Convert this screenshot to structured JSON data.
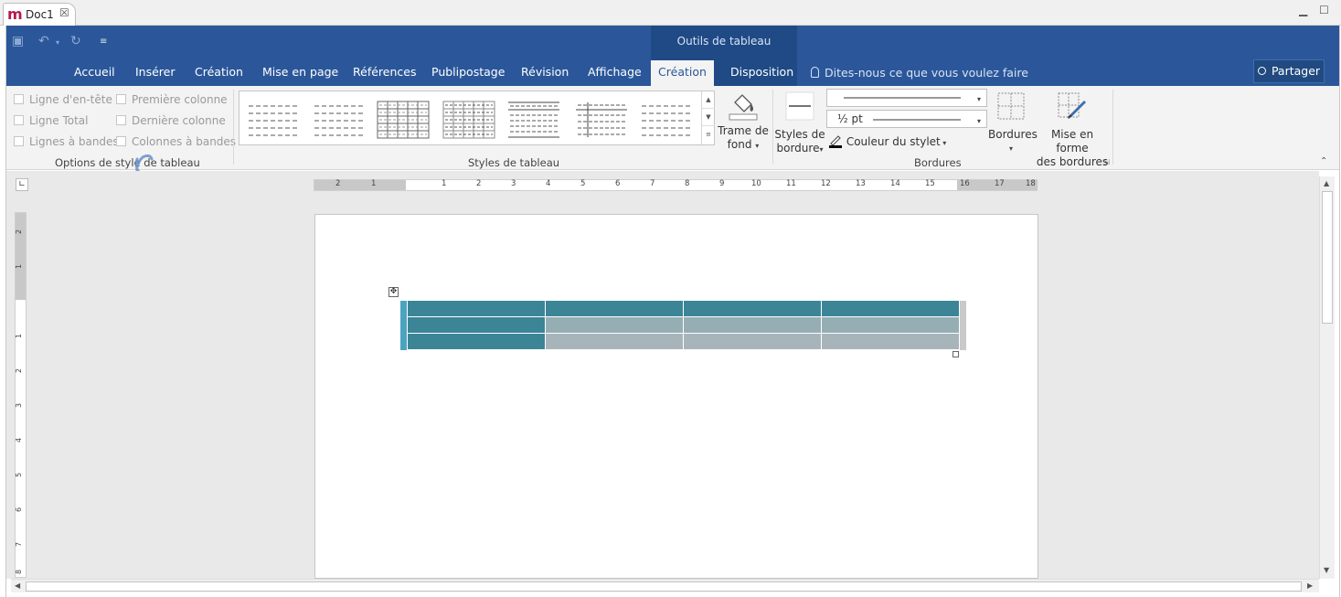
{
  "window": {
    "doc_title": "Doc1",
    "app_logo": "m"
  },
  "context_group_label": "Outils de tableau",
  "tabs": [
    "Accueil",
    "Insérer",
    "Création",
    "Mise en page",
    "Références",
    "Publipostage",
    "Révision",
    "Affichage",
    "Création",
    "Disposition"
  ],
  "active_tab_index": 8,
  "tell_me": "Dites-nous ce que vous voulez faire",
  "share_label": "Partager",
  "style_options": {
    "label": "Options de style de tableau",
    "items": [
      "Ligne d'en-tête",
      "Ligne Total",
      "Lignes à bandes",
      "Première colonne",
      "Dernière colonne",
      "Colonnes à bandes"
    ]
  },
  "table_styles": {
    "label": "Styles de tableau",
    "count": 7
  },
  "shading": {
    "line1": "Trame de",
    "line2": "fond"
  },
  "borders": {
    "label": "Bordures",
    "border_styles_line1": "Styles de",
    "border_styles_line2": "bordure",
    "weight": "½ pt",
    "pen_color": "Couleur du stylet",
    "borders_button": "Bordures",
    "painter_line1": "Mise en forme",
    "painter_line2": "des bordures"
  },
  "ruler": {
    "h_numbers": [
      "2",
      "1",
      "1",
      "2",
      "3",
      "4",
      "5",
      "6",
      "7",
      "8",
      "9",
      "10",
      "11",
      "12",
      "13",
      "14",
      "15",
      "16",
      "17",
      "18"
    ],
    "v_numbers": [
      "2",
      "1",
      "1",
      "2",
      "3",
      "4",
      "5",
      "6",
      "7",
      "8"
    ]
  },
  "colors": {
    "ribbon_blue": "#2b579a",
    "table_header": "#3b8597",
    "table_band": "#94aeb4"
  }
}
